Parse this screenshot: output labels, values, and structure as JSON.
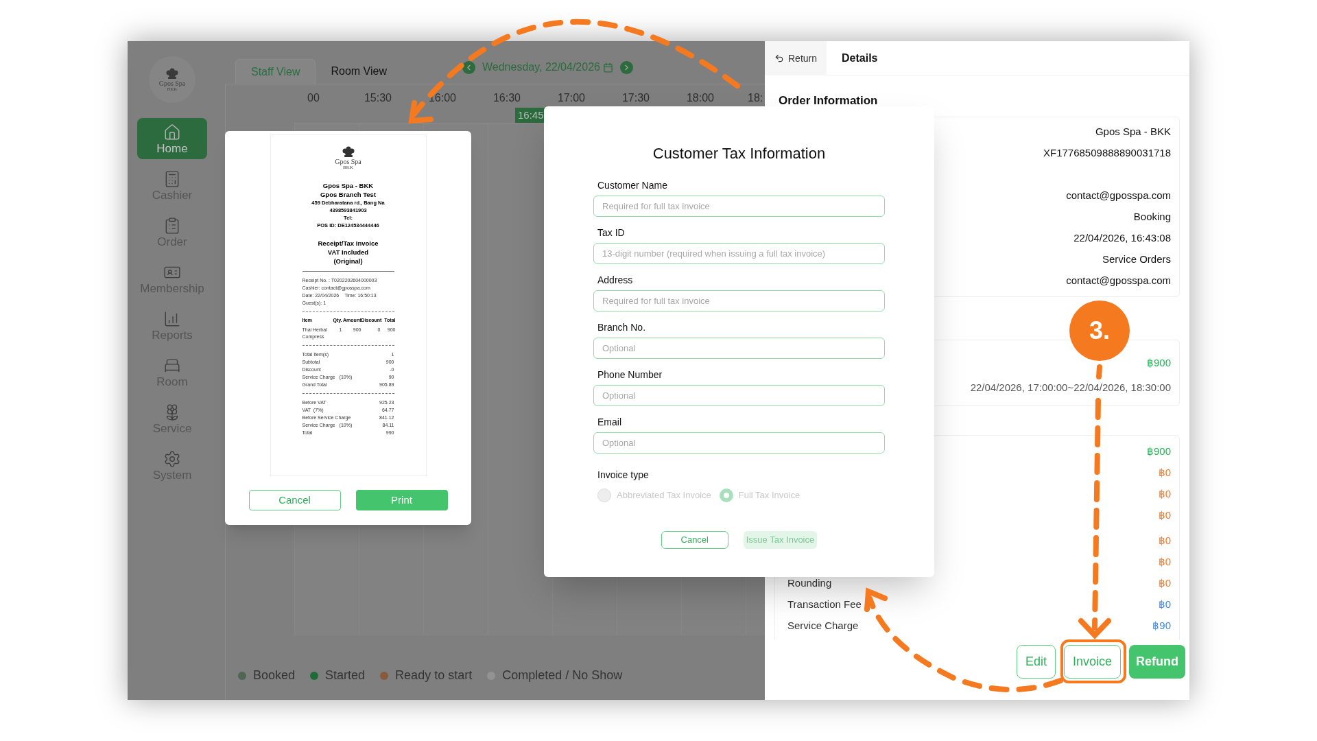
{
  "sidebar": {
    "logo": {
      "name": "Gpos Spa",
      "sub": "BKK"
    },
    "items": [
      {
        "label": "Home",
        "selected": true
      },
      {
        "label": "Cashier",
        "selected": false
      },
      {
        "label": "Order",
        "selected": false
      },
      {
        "label": "Membership",
        "selected": false
      },
      {
        "label": "Reports",
        "selected": false
      },
      {
        "label": "Room",
        "selected": false
      },
      {
        "label": "Service",
        "selected": false
      },
      {
        "label": "System",
        "selected": false
      }
    ]
  },
  "tabs": [
    {
      "label": "Staff View",
      "selected": true
    },
    {
      "label": "Room View",
      "selected": false
    }
  ],
  "date_nav": {
    "label": "Wednesday, 22/04/2026"
  },
  "timeline": {
    "times": [
      "00",
      "15:30",
      "16:00",
      "16:30",
      "17:00",
      "17:30",
      "18:00",
      "18:"
    ],
    "now": "16:45"
  },
  "legend": [
    {
      "label": "Booked",
      "color": "#4f6654"
    },
    {
      "label": "Started",
      "color": "#1e6b38"
    },
    {
      "label": "Ready to start",
      "color": "#8a5a3c"
    },
    {
      "label": "Completed / No Show",
      "color": "#939393"
    }
  ],
  "receipt_dialog": {
    "logo": {
      "name": "Gpos Spa",
      "sub": "BKK"
    },
    "header": [
      "Gpos Spa - BKK",
      "Gpos Branch Test",
      "459 Debharatana rd., Bang Na",
      "4398593841903",
      "Tel:",
      "POS ID: DE124534444446"
    ],
    "title": [
      "Receipt/Tax Invoice",
      "VAT Included",
      "(Original)"
    ],
    "info": [
      {
        "text": "Receipt No. : T0202202604000003"
      },
      {
        "text": "Cashier: contact@gposspa.com"
      },
      {
        "text": "Date: 22/04/2026",
        "extra": "Time: 16:50:13"
      },
      {
        "text": "Guest(s): 1"
      }
    ],
    "columns": [
      "Item",
      "Qty.",
      "Amount",
      "Discount",
      "Total"
    ],
    "items": [
      {
        "cells": [
          "Thai Herbal Compress",
          "1",
          "900",
          "0",
          "900"
        ]
      }
    ],
    "totals": [
      {
        "label": "Total Item(s)",
        "value": "1"
      },
      {
        "label": "Subtotal",
        "value": "900"
      },
      {
        "label": "Discount",
        "value": "-0"
      },
      {
        "label": "Service Charge   (10%)",
        "value": "90"
      },
      {
        "label": "Grand Total",
        "value": "905.89"
      }
    ],
    "tax": [
      {
        "label": "Before VAT",
        "value": "925.23"
      },
      {
        "label": "VAT  (7%)",
        "value": "64.77"
      },
      {
        "label": "Before Service Charge",
        "value": "841.12"
      },
      {
        "label": "Service Charge   (10%)",
        "value": "84.11"
      },
      {
        "label": "Total",
        "value": "990"
      }
    ],
    "buttons": [
      {
        "label": "Cancel",
        "kind": "outline"
      },
      {
        "label": "Print",
        "kind": "solid"
      }
    ]
  },
  "details_panel": {
    "tabs": [
      {
        "label": "Return",
        "selected": false
      },
      {
        "label": "Details",
        "selected": true
      }
    ],
    "heading": "Order Information",
    "order_rows": [
      "Gpos Spa - BKK",
      "XF17768509888890031718",
      "contact@gposspa.com",
      "Booking",
      "22/04/2026, 16:43:08",
      "Service Orders",
      "contact@gposspa.com"
    ],
    "service": {
      "price": "฿900",
      "period": "22/04/2026, 17:00:00~22/04/2026, 18:30:00"
    },
    "charges": [
      {
        "value": "฿900",
        "color": "#22b455"
      },
      {
        "value": "฿0",
        "color": "#f0782a"
      },
      {
        "value": "฿0",
        "color": "#f0782a"
      },
      {
        "value": "฿0",
        "color": "#f0782a"
      },
      {
        "value": "฿0",
        "color": "#f0782a"
      },
      {
        "value": "฿0",
        "color": "#f0782a"
      },
      {
        "label": "Rounding",
        "value": "฿0",
        "color": "#f0782a"
      },
      {
        "label": "Transaction Fee",
        "value": "฿0",
        "color": "#3d86f0"
      },
      {
        "label": "Service Charge",
        "value": "฿90",
        "color": "#3d86f0"
      }
    ],
    "buttons": [
      {
        "label": "Edit",
        "kind": "outline"
      },
      {
        "label": "Invoice",
        "kind": "outline"
      },
      {
        "label": "Refund",
        "kind": "solid"
      }
    ]
  },
  "tax_dialog": {
    "title": "Customer Tax Information",
    "fields": [
      {
        "label": "Customer Name",
        "placeholder": "Required for full tax invoice"
      },
      {
        "label": "Tax ID",
        "placeholder": "13-digit number (required when issuing a full tax invoice)"
      },
      {
        "label": "Address",
        "placeholder": "Required for full tax invoice"
      },
      {
        "label": "Branch No.",
        "placeholder": "Optional"
      },
      {
        "label": "Phone Number",
        "placeholder": "Optional"
      },
      {
        "label": "Email",
        "placeholder": "Optional"
      }
    ],
    "invoice_type": {
      "label": "Invoice type",
      "disabled": true,
      "options": [
        {
          "label": "Abbreviated Tax Invoice",
          "selected": false
        },
        {
          "label": "Full Tax Invoice",
          "selected": true
        }
      ]
    },
    "buttons": [
      {
        "label": "Cancel",
        "kind": "outline"
      },
      {
        "label": "Issue Tax Invoice",
        "kind": "solid",
        "disabled": true
      }
    ]
  },
  "annotation": {
    "step": "3."
  }
}
